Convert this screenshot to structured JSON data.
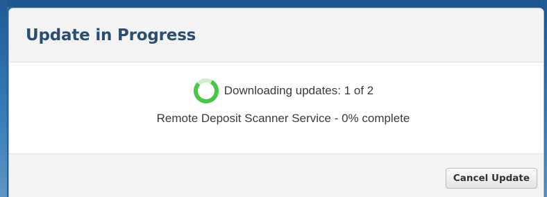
{
  "dialog": {
    "title": "Update in Progress",
    "status_text": "Downloading updates: 1 of 2",
    "detail_text": "Remote Deposit Scanner Service - 0% complete",
    "progress_percent": 0,
    "spinner_icon": "loading-spinner-icon",
    "cancel_label": "Cancel Update"
  },
  "colors": {
    "title": "#2b4d6e",
    "spinner": "#4cc44a",
    "backdrop": "#2d6da4"
  }
}
